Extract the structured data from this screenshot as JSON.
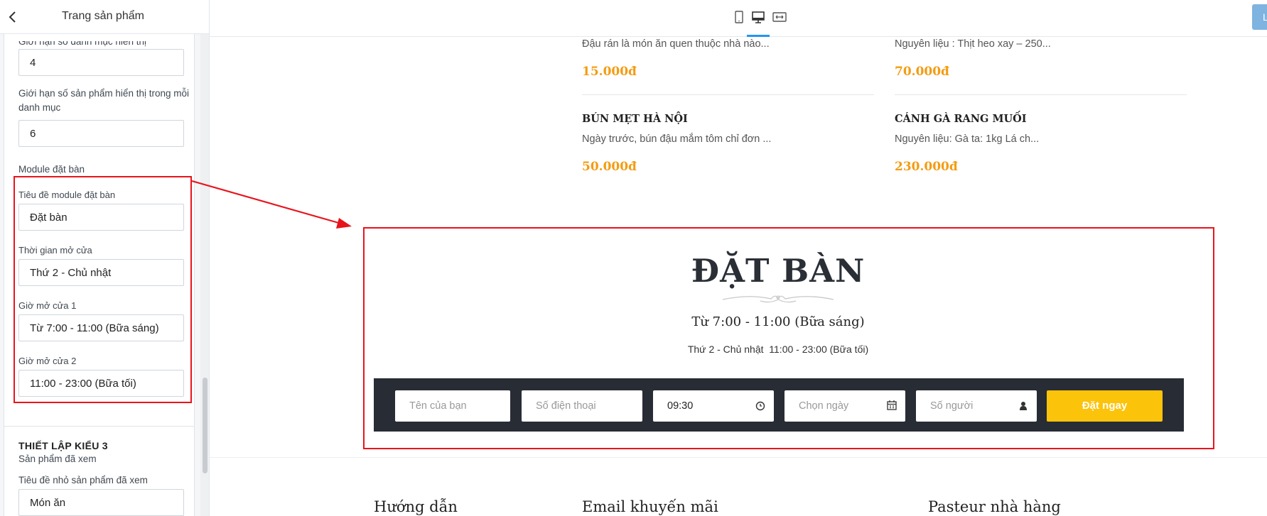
{
  "panel": {
    "title": "Trang sản phẩm",
    "fields": {
      "category_limit": {
        "label": "Giới hạn số danh mục hiển thị",
        "value": "4"
      },
      "product_limit": {
        "label": "Giới hạn số sản phẩm hiển thị trong mỗi danh mục",
        "value": "6"
      },
      "module_label": "Module đặt bàn",
      "booking_title": {
        "label": "Tiêu đề module đặt bàn",
        "value": "Đặt bàn"
      },
      "open_days": {
        "label": "Thời gian mở cửa",
        "value": "Thứ 2 - Chủ nhật"
      },
      "hours1": {
        "label": "Giờ mở cửa 1",
        "value": "Từ 7:00 - 11:00 (Bữa sáng)"
      },
      "hours2": {
        "label": "Giờ mở cửa 2",
        "value": "11:00 - 23:00 (Bữa tối)"
      }
    },
    "style3": {
      "title": "THIẾT LẬP KIỂU 3",
      "subtitle": "Sản phẩm đã xem",
      "small_title_label": "Tiêu đề nhỏ sản phẩm đã xem",
      "small_title_value": "Món ăn"
    }
  },
  "topbar": {
    "publish_label": "L",
    "devices": [
      "tablet-icon",
      "desktop-icon",
      "fullwidth-icon"
    ],
    "active_device": "desktop-icon"
  },
  "products": [
    {
      "desc": "Đậu rán là món ăn quen thuộc nhà nào...",
      "price": "15.000đ"
    },
    {
      "desc": "Nguyên liệu : Thịt heo xay – 250...",
      "price": "70.000đ"
    },
    {
      "name": "BÚN MẸT HÀ NỘI",
      "desc": "Ngày trước, bún đậu mắm tôm chỉ đơn ...",
      "price": "50.000đ"
    },
    {
      "name": "CÁNH GÀ RANG MUỐI",
      "desc": "Nguyên liệu: Gà ta: 1kg Lá ch...",
      "price": "230.000đ"
    }
  ],
  "booking": {
    "title": "ĐẶT BÀN",
    "hours1": "Từ 7:00 - 11:00 (Bữa sáng)",
    "hours2": "Thứ 2 - Chủ nhật  11:00 - 23:00 (Bữa tối)",
    "name_placeholder": "Tên của bạn",
    "phone_placeholder": "Số điện thoại",
    "time_value": "09:30",
    "date_placeholder": "Chọn ngày",
    "people_placeholder": "Số người",
    "submit_label": "Đặt ngay"
  },
  "footer": {
    "col1": "Hướng dẫn",
    "col2": "Email khuyến mãi",
    "col3": "Pasteur nhà hàng"
  },
  "colors": {
    "highlight": "#e8141c",
    "price": "#f39c12",
    "submit": "#fcc30b",
    "bar": "#282c35",
    "active_tab": "#2196f3"
  }
}
